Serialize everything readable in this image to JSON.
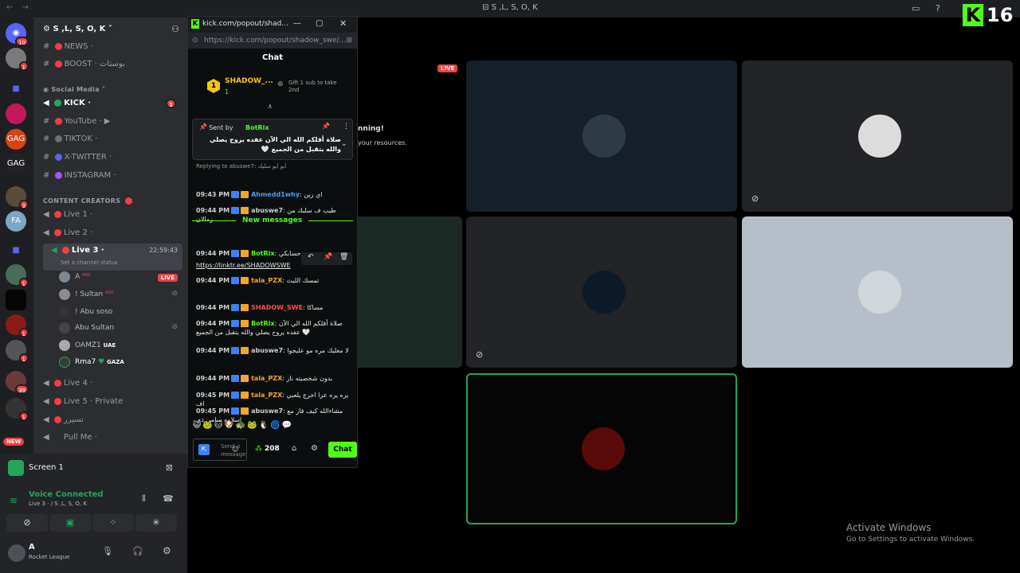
{
  "window": {
    "title": "S ,L, S, O, K",
    "nav": "← →"
  },
  "overlay": {
    "channel_number": "16"
  },
  "servers": [
    {
      "name": "discord-home",
      "badge": "10"
    },
    {
      "name": "server-2",
      "badge": "1"
    },
    {
      "name": "server-3",
      "badge": ""
    },
    {
      "name": "server-4",
      "badge": ""
    },
    {
      "name": "server-5",
      "badge": ""
    },
    {
      "name": "server-6",
      "badge": ""
    },
    {
      "name": "server-7",
      "badge": "3"
    },
    {
      "name": "server-8",
      "badge": ""
    },
    {
      "name": "server-9",
      "badge": ""
    },
    {
      "name": "server-10",
      "badge": "1"
    },
    {
      "name": "server-11",
      "badge": ""
    },
    {
      "name": "server-12",
      "badge": "1"
    },
    {
      "name": "server-13",
      "badge": "1"
    },
    {
      "name": "server-14",
      "badge": "39"
    },
    {
      "name": "server-15",
      "badge": "1"
    }
  ],
  "new_pill": "NEW",
  "guild": {
    "name": "S ,L, S, O, K"
  },
  "channels": {
    "news": "NEWS ·",
    "boost": "BOOST · بوستات",
    "social_category": "Social Media",
    "kick": "KICK ·",
    "kick_badge": "1",
    "youtube": "YouTube · ▶",
    "tiktok": "TIKTOK ·",
    "xtwitter": "X-TWITTER ·",
    "instagram": "INSTAGRAM ·",
    "creators_category": "CONTENT CREATORS",
    "live1": "Live 1 ·",
    "live2": "Live 2 ·",
    "live3": "Live 3 ·",
    "live3_time": "22:59:43",
    "live3_status": "Set a channel status",
    "live4": "Live 4 ·",
    "live5": "Live 5 · Private",
    "special": "تسيرر",
    "pullme": "Pull Me ·"
  },
  "voice_users": [
    {
      "name": "A",
      "tag": "ᵟᵟᵟ",
      "live": "LIVE",
      "color": "#7e8891"
    },
    {
      "name": "! Sultan",
      "tag": "ᵟᵟᵟ",
      "live": "",
      "color": "#8c8c8c"
    },
    {
      "name": "! Abu soso",
      "tag": "",
      "live": "",
      "color": "#333"
    },
    {
      "name": "Abu Sultan",
      "tag": "",
      "live": "",
      "color": "#444"
    },
    {
      "name": "OAMZ1",
      "tag": "UAE",
      "live": "",
      "color": "#aaa"
    },
    {
      "name": "Rma7",
      "tag": "GAZA",
      "live": "",
      "color": "#3a3a3a"
    }
  ],
  "screen_share": {
    "label": "Screen 1"
  },
  "voice": {
    "status": "Voice Connected",
    "location": "Live 3 · / S ,L, S, O, K"
  },
  "user": {
    "name": "A",
    "activity": "Rocket League"
  },
  "popout": {
    "tab_title": "kick.com/popout/shad...",
    "url": "https://kick.com/popout/shadow_swe/...",
    "chat_title": "Chat",
    "leader_name": "SHADOW_...",
    "leader_count": "1",
    "gift_text": "Gift 1 sub to take 2nd",
    "pinned_by_label": "Sent by",
    "pinned_by": "BotRix",
    "pinned_text": "صلاة أقلكم الله الي الآن عفده يروح يصلي والله يتقبل من الجميع 🤍",
    "replying": "Replying to abuswe7: ابو ابو سليك",
    "new_messages": "New messages",
    "messages": [
      {
        "time": "09:43 PM",
        "user": "Ahmedd1why",
        "color": "#3ea6ff",
        "text": "اي زين"
      },
      {
        "time": "09:44 PM",
        "user": "abuswe7",
        "color": "#cfcfcf",
        "text": "طيب ف سلبك من زمالان"
      },
      {
        "time": "09:44 PM",
        "user": "BotRix",
        "color": "#53fc18",
        "text": "حسابكي"
      },
      {
        "time": "",
        "user": "",
        "color": "#fff",
        "text": "https://linktr.ee/SHADOWSWE"
      },
      {
        "time": "09:44 PM",
        "user": "tala_PZX",
        "color": "#f5a623",
        "text": "تمسك الليث"
      },
      {
        "time": "09:44 PM",
        "user": "SHADOW_SWE",
        "color": "#ff4d4d",
        "text": "مساكا"
      },
      {
        "time": "09:44 PM",
        "user": "BotRix",
        "color": "#53fc18",
        "text": "صلاة أقلكم الله الي الآن عفده يروح يصلي والله يتقبل من الجميع 🤍"
      },
      {
        "time": "09:44 PM",
        "user": "abuswe7",
        "color": "#cfcfcf",
        "text": "لا معليك مره مو عليجوا"
      },
      {
        "time": "09:44 PM",
        "user": "tala_PZX",
        "color": "#f5a623",
        "text": "بدون شخصيته ناز"
      },
      {
        "time": "09:45 PM",
        "user": "tala_PZX",
        "color": "#f5a623",
        "text": "يره يره عزا اخرج يلعبي اف"
      },
      {
        "time": "09:45 PM",
        "user": "abuswe7",
        "color": "#cfcfcf",
        "text": "مشاءالله كيف فاز مع اسلامه سامي ذي"
      }
    ],
    "input_placeholder": "Send a message",
    "points": "208",
    "chat_button": "Chat"
  },
  "stage": {
    "live_badge": "LIVE",
    "notice_line1": "nning!",
    "notice_line2": "your resources."
  },
  "activate": {
    "title": "Activate Windows",
    "subtitle": "Go to Settings to activate Windows."
  },
  "colors": {
    "kick_green": "#53fc18",
    "discord_red": "#f23f43",
    "voice_green": "#23a55a",
    "accent": "#5865f2"
  }
}
